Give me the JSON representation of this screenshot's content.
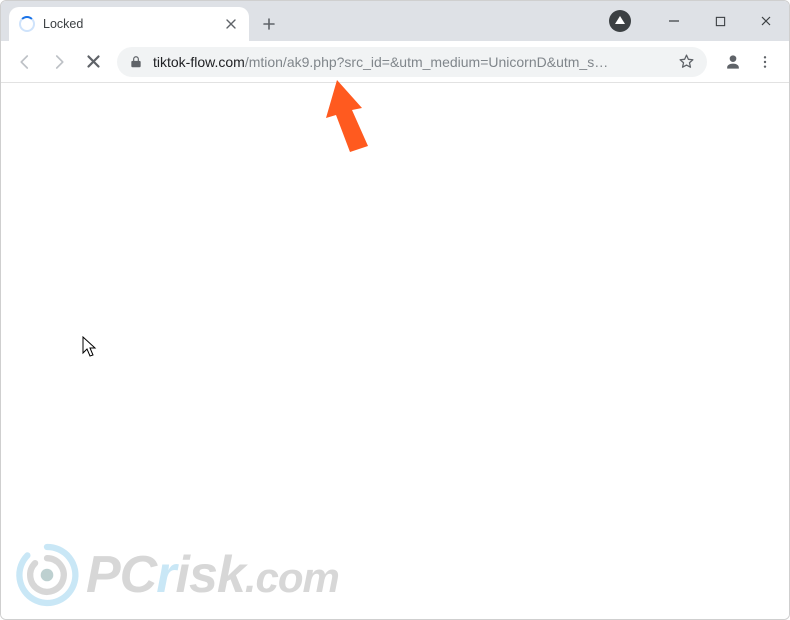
{
  "window": {
    "tab_title": "Locked",
    "loading": true
  },
  "toolbar": {
    "url_domain": "tiktok-flow.com",
    "url_path": "/mtion/ak9.php?src_id=&utm_medium=UnicornD&utm_s…"
  },
  "annotation": {
    "arrow_color": "#ff5a1f"
  },
  "watermark": {
    "text_pc": "PC",
    "text_r": "r",
    "text_isk": "isk",
    "text_com": ".com"
  },
  "colors": {
    "tab_strip_bg": "#dee1e6",
    "omnibox_bg": "#f1f3f4",
    "accent_blue": "#1a73e8"
  }
}
